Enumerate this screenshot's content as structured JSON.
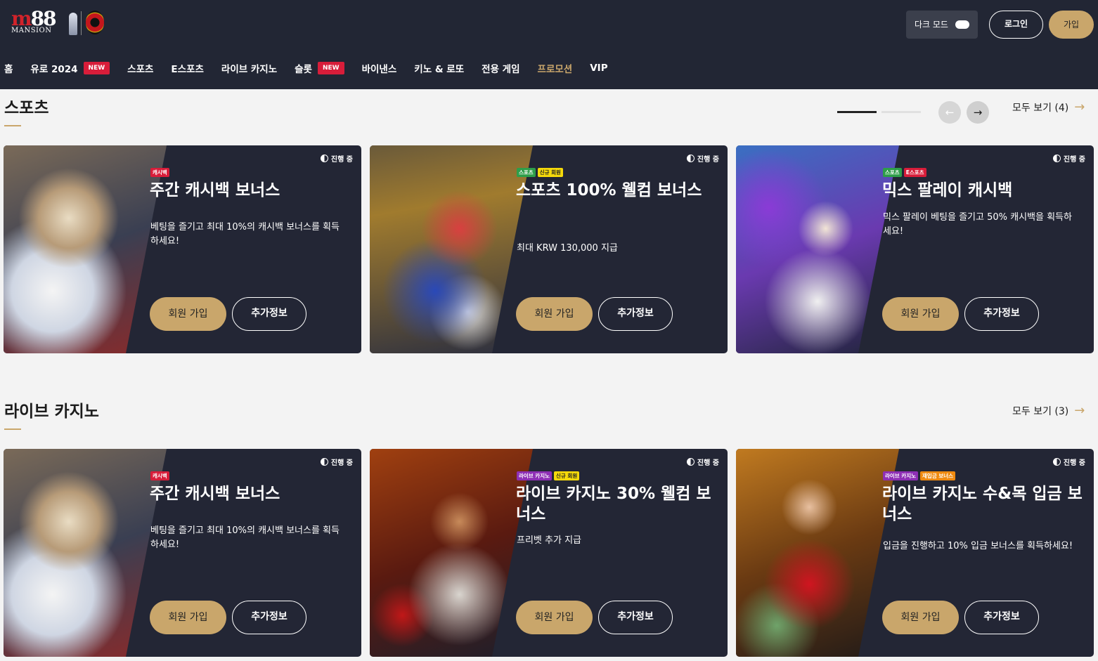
{
  "header": {
    "logo_text": "M88",
    "logo_sub": "MANSION",
    "dark_mode_label": "다크 모드",
    "login_label": "로그인",
    "join_label": "가입"
  },
  "nav": [
    {
      "label": "홈",
      "badge": ""
    },
    {
      "label": "유로 2024",
      "badge": "NEW"
    },
    {
      "label": "스포츠",
      "badge": ""
    },
    {
      "label": "E스포츠",
      "badge": ""
    },
    {
      "label": "라이브 카지노",
      "badge": ""
    },
    {
      "label": "슬롯",
      "badge": "NEW"
    },
    {
      "label": "바이낸스",
      "badge": ""
    },
    {
      "label": "키노 & 로또",
      "badge": ""
    },
    {
      "label": "전용 게임",
      "badge": ""
    },
    {
      "label": "프로모션",
      "badge": ""
    },
    {
      "label": "VIP",
      "badge": ""
    }
  ],
  "colors": {
    "accent": "#c9a66b",
    "header_bg": "#222634",
    "card_bg": "#232635",
    "new_badge": "#d81d3a"
  },
  "sections": [
    {
      "title": "스포츠",
      "view_all": "모두 보기 (4)",
      "cards": [
        {
          "status": "진행 중",
          "tags": [
            {
              "text": "캐시백",
              "color": "#d81d3a",
              "fg": "#ffffff"
            }
          ],
          "title": "주간 캐시백 보너스",
          "desc": "베팅을 즐기고 최대 10%의 캐시백 보너스를 획득하세요!",
          "join": "회원 가입",
          "info": "추가정보"
        },
        {
          "status": "진행 중",
          "tags": [
            {
              "text": "스포츠",
              "color": "#2e9e4a",
              "fg": "#ffffff"
            },
            {
              "text": "신규 회원",
              "color": "#f5d90a",
              "fg": "#222222"
            }
          ],
          "title": "스포츠 100% 웰컴 보너스",
          "desc": "최대 KRW 130,000 지급",
          "join": "회원 가입",
          "info": "추가정보"
        },
        {
          "status": "진행 중",
          "tags": [
            {
              "text": "스포츠",
              "color": "#2e9e4a",
              "fg": "#ffffff"
            },
            {
              "text": "E스포츠",
              "color": "#d81d3a",
              "fg": "#ffffff"
            }
          ],
          "title": "믹스 팔레이 캐시백",
          "desc": "믹스 팔레이 베팅을 즐기고 50% 캐시백을 획득하세요!",
          "join": "회원 가입",
          "info": "추가정보"
        }
      ]
    },
    {
      "title": "라이브 카지노",
      "view_all": "모두 보기 (3)",
      "cards": [
        {
          "status": "진행 중",
          "tags": [
            {
              "text": "캐시백",
              "color": "#d81d3a",
              "fg": "#ffffff"
            }
          ],
          "title": "주간 캐시백 보너스",
          "desc": "베팅을 즐기고 최대 10%의 캐시백 보너스를 획득하세요!",
          "join": "회원 가입",
          "info": "추가정보"
        },
        {
          "status": "진행 중",
          "tags": [
            {
              "text": "라이브 카지노",
              "color": "#8e2fb5",
              "fg": "#ffffff"
            },
            {
              "text": "신규 회원",
              "color": "#f5d90a",
              "fg": "#222222"
            }
          ],
          "title": "라이브 카지노 30% 웰컴 보너스",
          "desc": "프리벳 추가 지급",
          "join": "회원 가입",
          "info": "추가정보"
        },
        {
          "status": "진행 중",
          "tags": [
            {
              "text": "라이브 카지노",
              "color": "#8e2fb5",
              "fg": "#ffffff"
            },
            {
              "text": "재입금 보너스",
              "color": "#f08a10",
              "fg": "#ffffff"
            }
          ],
          "title": "라이브 카지노 수&목 입금 보너스",
          "desc": "입금을 진행하고 10% 입금 보너스를 획득하세요!",
          "join": "회원 가입",
          "info": "추가정보"
        }
      ]
    }
  ],
  "carousel": {
    "prev": "←",
    "next": "→"
  }
}
